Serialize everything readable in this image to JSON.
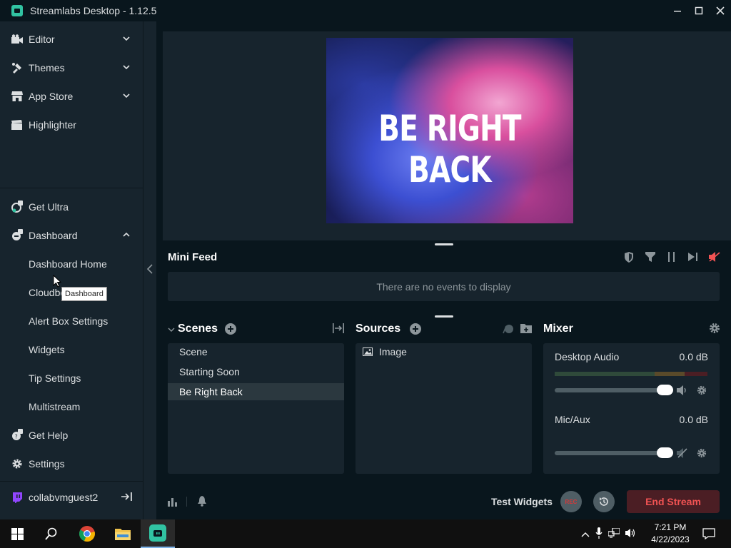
{
  "window": {
    "title": "Streamlabs Desktop - 1.12.5"
  },
  "sidebar": {
    "top_items": [
      {
        "label": "Editor"
      },
      {
        "label": "Themes"
      },
      {
        "label": "App Store"
      },
      {
        "label": "Highlighter"
      }
    ],
    "get_ultra": "Get Ultra",
    "dashboard": "Dashboard",
    "dashboard_sub": [
      "Dashboard Home",
      "Cloudbot",
      "Alert Box Settings",
      "Widgets",
      "Tip Settings",
      "Multistream"
    ],
    "get_help": "Get Help",
    "settings": "Settings",
    "user": "collabvmguest2"
  },
  "tooltip": "Dashboard",
  "preview": {
    "overlay_text": "BE RIGHT BACK"
  },
  "minifeed": {
    "title": "Mini Feed",
    "empty": "There are no events to display"
  },
  "scenes": {
    "title": "Scenes",
    "items": [
      "Scene",
      "Starting Soon",
      "Be Right Back"
    ],
    "active": "Be Right Back"
  },
  "sources": {
    "title": "Sources",
    "items": [
      "Image"
    ]
  },
  "mixer": {
    "title": "Mixer",
    "channels": [
      {
        "name": "Desktop Audio",
        "db": "0.0 dB",
        "muted": false
      },
      {
        "name": "Mic/Aux",
        "db": "0.0 dB",
        "muted": true
      }
    ]
  },
  "footer": {
    "test_widgets": "Test Widgets",
    "rec": "REC",
    "end_stream": "End Stream"
  },
  "taskbar": {
    "time": "7:21 PM",
    "date": "4/22/2023"
  },
  "colors": {
    "accent": "#31c3a2",
    "danger": "#f15353",
    "panel": "#17242d",
    "background": "#09161d"
  }
}
